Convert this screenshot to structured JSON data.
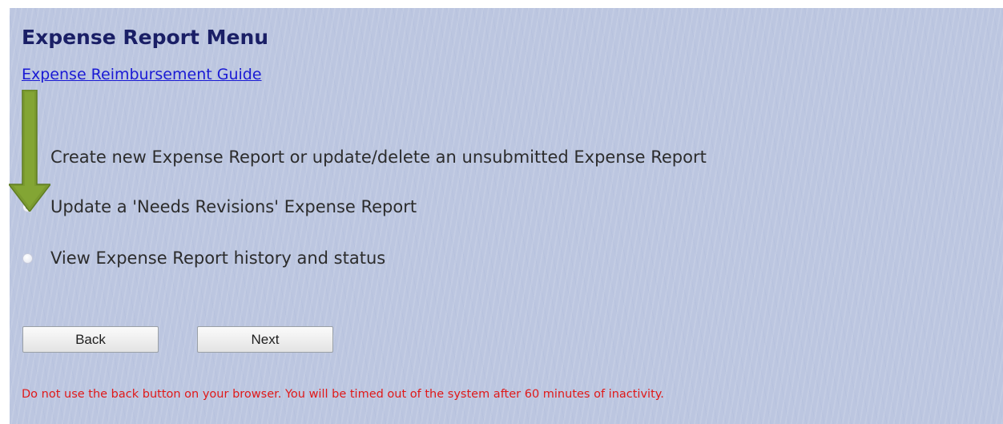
{
  "page": {
    "title": "Expense Report Menu",
    "guide_link": "Expense Reimbursement Guide"
  },
  "options": [
    {
      "label": "Create new Expense Report or update/delete an unsubmitted Expense Report",
      "selected": false,
      "radio_visible": false
    },
    {
      "label": "Update a 'Needs Revisions' Expense Report",
      "selected": true
    },
    {
      "label": "View Expense Report history and status",
      "selected": false
    }
  ],
  "buttons": {
    "back_label": "Back",
    "next_label": "Next"
  },
  "warning": "Do not use the back button on your browser. You will be timed out of the system after 60 minutes of inactivity.",
  "annotation": {
    "arrow_icon": "down-arrow-icon",
    "arrow_color": "#7a9a2f"
  },
  "colors": {
    "background": "#bcc6e0",
    "title": "#1a1f66",
    "link": "#1a1ad4",
    "warning": "#e01919"
  }
}
